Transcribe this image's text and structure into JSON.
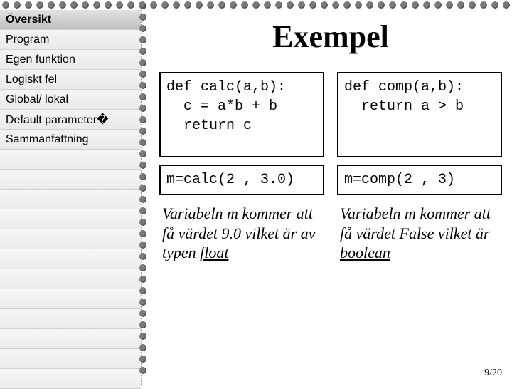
{
  "sidebar": {
    "items": [
      {
        "label": "Översikt",
        "active": true
      },
      {
        "label": "Program",
        "active": false
      },
      {
        "label": "Egen funktion",
        "active": false
      },
      {
        "label": "Logiskt fel",
        "active": false
      },
      {
        "label": "Global/ lokal",
        "active": false
      },
      {
        "label": "Default parameter�",
        "active": false
      },
      {
        "label": "Sammanfattning",
        "active": false
      }
    ]
  },
  "main": {
    "title": "Exempel",
    "left": {
      "code": "def calc(a,b):\n  c = a*b + b\n  return c",
      "call": "m=calc(2 , 3.0)",
      "explain_pre": "Variabeln m kommer att få värdet 9.0 vilket är av typen ",
      "explain_type": "float"
    },
    "right": {
      "code": "def comp(a,b):\n  return a > b",
      "call": "m=comp(2 , 3)",
      "explain_pre": "Variabeln m kommer att få värdet False vilket är ",
      "explain_type": "boolean"
    }
  },
  "page": {
    "label": "9/20"
  }
}
